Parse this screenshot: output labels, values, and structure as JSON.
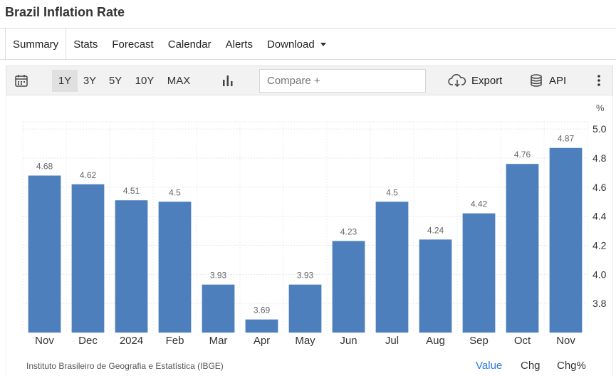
{
  "page": {
    "title": "Brazil Inflation Rate"
  },
  "tabs": [
    {
      "label": "Summary",
      "active": true
    },
    {
      "label": "Stats"
    },
    {
      "label": "Forecast"
    },
    {
      "label": "Calendar"
    },
    {
      "label": "Alerts"
    },
    {
      "label": "Download",
      "has_dropdown": true
    }
  ],
  "toolbar": {
    "calendar_icon": "calendar-icon",
    "ranges": [
      {
        "label": "1Y",
        "active": true
      },
      {
        "label": "3Y"
      },
      {
        "label": "5Y"
      },
      {
        "label": "10Y"
      },
      {
        "label": "MAX"
      }
    ],
    "chart_type_icon": "bar-chart-icon",
    "compare_placeholder": "Compare +",
    "export_icon": "cloud-download-icon",
    "export_label": "Export",
    "api_icon": "database-icon",
    "api_label": "API",
    "more_icon": "more-vertical-icon"
  },
  "footer": {
    "source": "Instituto Brasileiro de Geografia e Estatística (IBGE)",
    "views": [
      {
        "label": "Value",
        "active": true
      },
      {
        "label": "Chg"
      },
      {
        "label": "Chg%"
      }
    ]
  },
  "chart_data": {
    "type": "bar",
    "categories": [
      "Nov",
      "Dec",
      "2024",
      "Feb",
      "Mar",
      "Apr",
      "May",
      "Jun",
      "Jul",
      "Aug",
      "Sep",
      "Oct",
      "Nov"
    ],
    "values": [
      4.68,
      4.62,
      4.51,
      4.5,
      3.93,
      3.69,
      3.93,
      4.23,
      4.5,
      4.24,
      4.42,
      4.76,
      4.87
    ],
    "data_labels": [
      "4.68",
      "4.62",
      "4.51",
      "4.5",
      "3.93",
      "3.69",
      "3.93",
      "4.23",
      "4.5",
      "4.24",
      "4.42",
      "4.76",
      "4.87"
    ],
    "unit": "%",
    "yticks": [
      "3.8",
      "4.0",
      "4.2",
      "4.4",
      "4.6",
      "4.8",
      "5.0"
    ],
    "ylim": [
      3.6,
      5.05
    ],
    "y_axis_position": "right",
    "grid": true,
    "bar_color": "#4d7fbd"
  }
}
